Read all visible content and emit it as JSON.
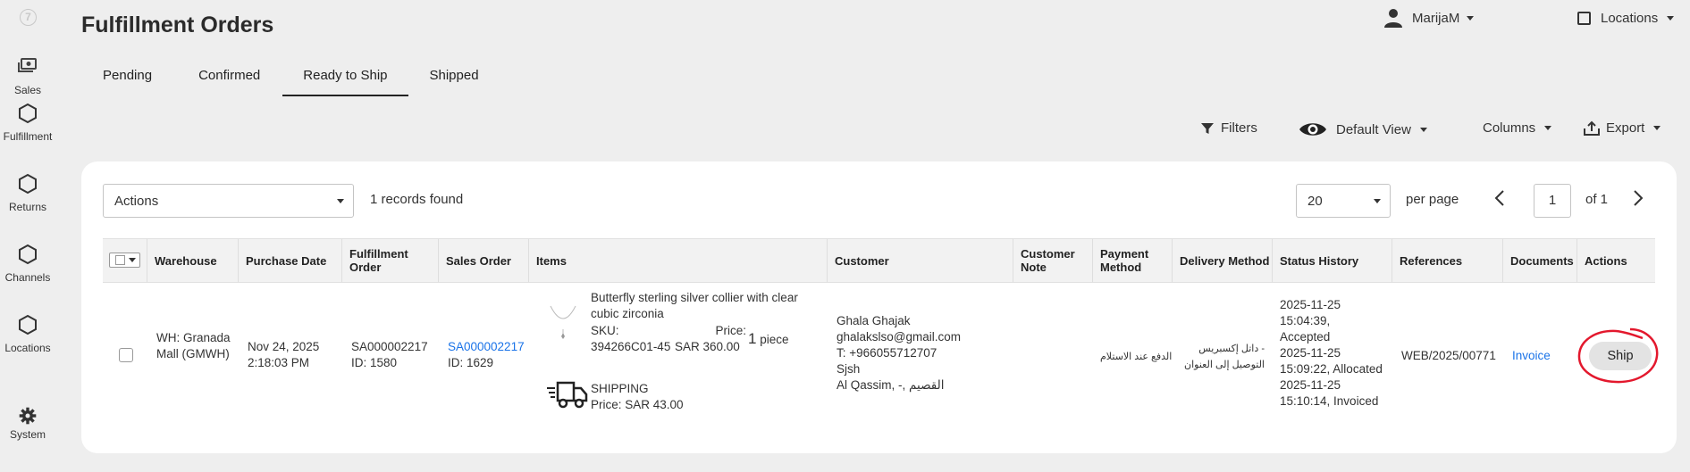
{
  "sidebar": {
    "items": [
      {
        "label": "Sales",
        "icon": "sales-icon"
      },
      {
        "label": "Fulfillment",
        "icon": "hexagon-icon"
      },
      {
        "label": "Returns",
        "icon": "hexagon-icon"
      },
      {
        "label": "Channels",
        "icon": "hexagon-icon"
      },
      {
        "label": "Locations",
        "icon": "hexagon-icon"
      },
      {
        "label": "System",
        "icon": "gear-icon"
      }
    ]
  },
  "header": {
    "title": "Fulfillment Orders",
    "user": "MarijaM",
    "locations": "Locations"
  },
  "tabs": [
    {
      "label": "Pending",
      "active": false
    },
    {
      "label": "Confirmed",
      "active": false
    },
    {
      "label": "Ready to Ship",
      "active": true
    },
    {
      "label": "Shipped",
      "active": false
    }
  ],
  "toolbar": {
    "filters": "Filters",
    "view": "Default View",
    "columns": "Columns",
    "export": "Export"
  },
  "grid": {
    "actions_select": "Actions",
    "records_found": "1 records found",
    "per_page_value": "20",
    "per_page_label": "per page",
    "page_value": "1",
    "of_label": "of 1"
  },
  "columns": [
    "Warehouse",
    "Purchase Date",
    "Fulfillment Order",
    "Sales Order",
    "Items",
    "Customer",
    "Customer Note",
    "Payment Method",
    "Delivery Method",
    "Status History",
    "References",
    "Documents",
    "Actions"
  ],
  "row": {
    "warehouse": "WH: Granada Mall (GMWH)",
    "purchase_date": "Nov 24, 2025 2:18:03 PM",
    "fulfillment_order": "SA000002217",
    "fulfillment_id": "ID: 1580",
    "sales_order": "SA000002217",
    "sales_id": "ID: 1629",
    "item_name": "Butterfly sterling silver collier with clear cubic zirconia",
    "sku_label": "SKU:",
    "sku": "394266C01-45",
    "price_label": "Price:",
    "price": "SAR 360.00",
    "qty_num": "1",
    "qty_unit": "piece",
    "shipping_label": "SHIPPING",
    "shipping_price": "Price: SAR 43.00",
    "customer_name": "Ghala Ghajak",
    "customer_email": "ghalakslso@gmail.com",
    "customer_phone": "T: +966055712707",
    "customer_city": "Sjsh",
    "customer_region": "Al Qassim, -, القصيم",
    "customer_note": "",
    "payment_method": "الدفع عند الاستلام",
    "delivery_method_1": "داتل إكسبريس -",
    "delivery_method_2": "التوصيل إلى العنوان",
    "status_1": "2025-11-25",
    "status_2": "15:04:39,",
    "status_3": "Accepted",
    "status_4": "2025-11-25",
    "status_5": "15:09:22, Allocated",
    "status_6": "2025-11-25",
    "status_7": "15:10:14, Invoiced",
    "reference": "WEB/2025/00771",
    "document": "Invoice",
    "action": "Ship"
  },
  "colors": {
    "link": "#1a73e8",
    "annotation": "#e3182d"
  }
}
